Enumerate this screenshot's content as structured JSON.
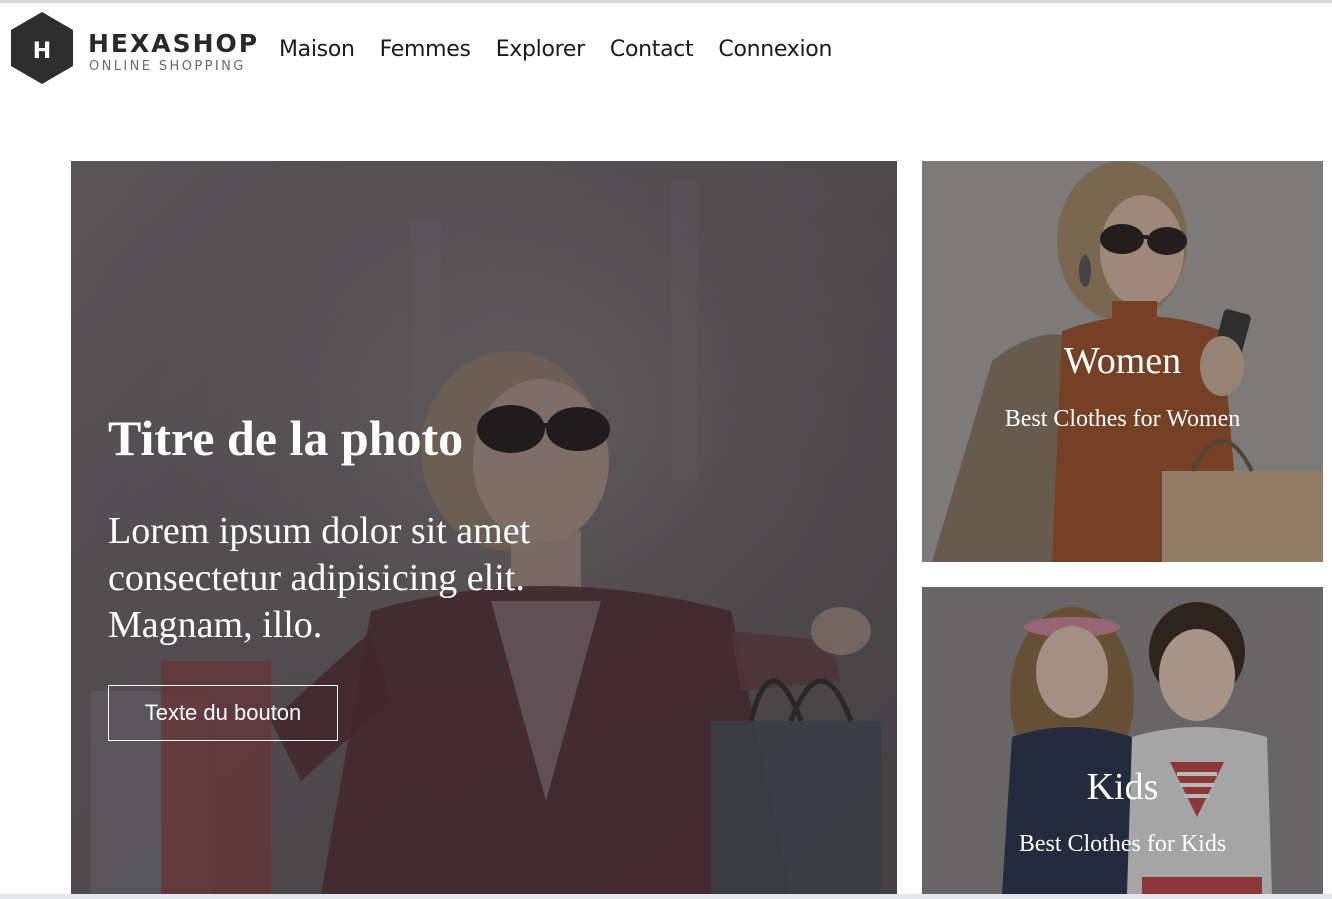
{
  "brand": {
    "logo_letter": "H",
    "name": "HEXASHOP",
    "tagline": "ONLINE SHOPPING"
  },
  "nav": {
    "items": [
      {
        "label": "Maison"
      },
      {
        "label": "Femmes"
      },
      {
        "label": "Explorer"
      },
      {
        "label": "Contact"
      },
      {
        "label": "Connexion"
      }
    ]
  },
  "hero": {
    "title": "Titre de la photo",
    "text": "Lorem ipsum dolor sit amet consectetur adipisicing elit. Magnam, illo.",
    "button_label": "Texte du bouton"
  },
  "cards": {
    "women": {
      "title": "Women",
      "subtitle": "Best Clothes for Women"
    },
    "kids": {
      "title": "Kids",
      "subtitle": "Best Clothes for Kids"
    }
  },
  "colors": {
    "brand_dark": "#2a2a2a",
    "hero_tint": "#5a5557",
    "text_light": "#ffffff"
  },
  "icons": [
    "hexagon-logo-icon"
  ]
}
